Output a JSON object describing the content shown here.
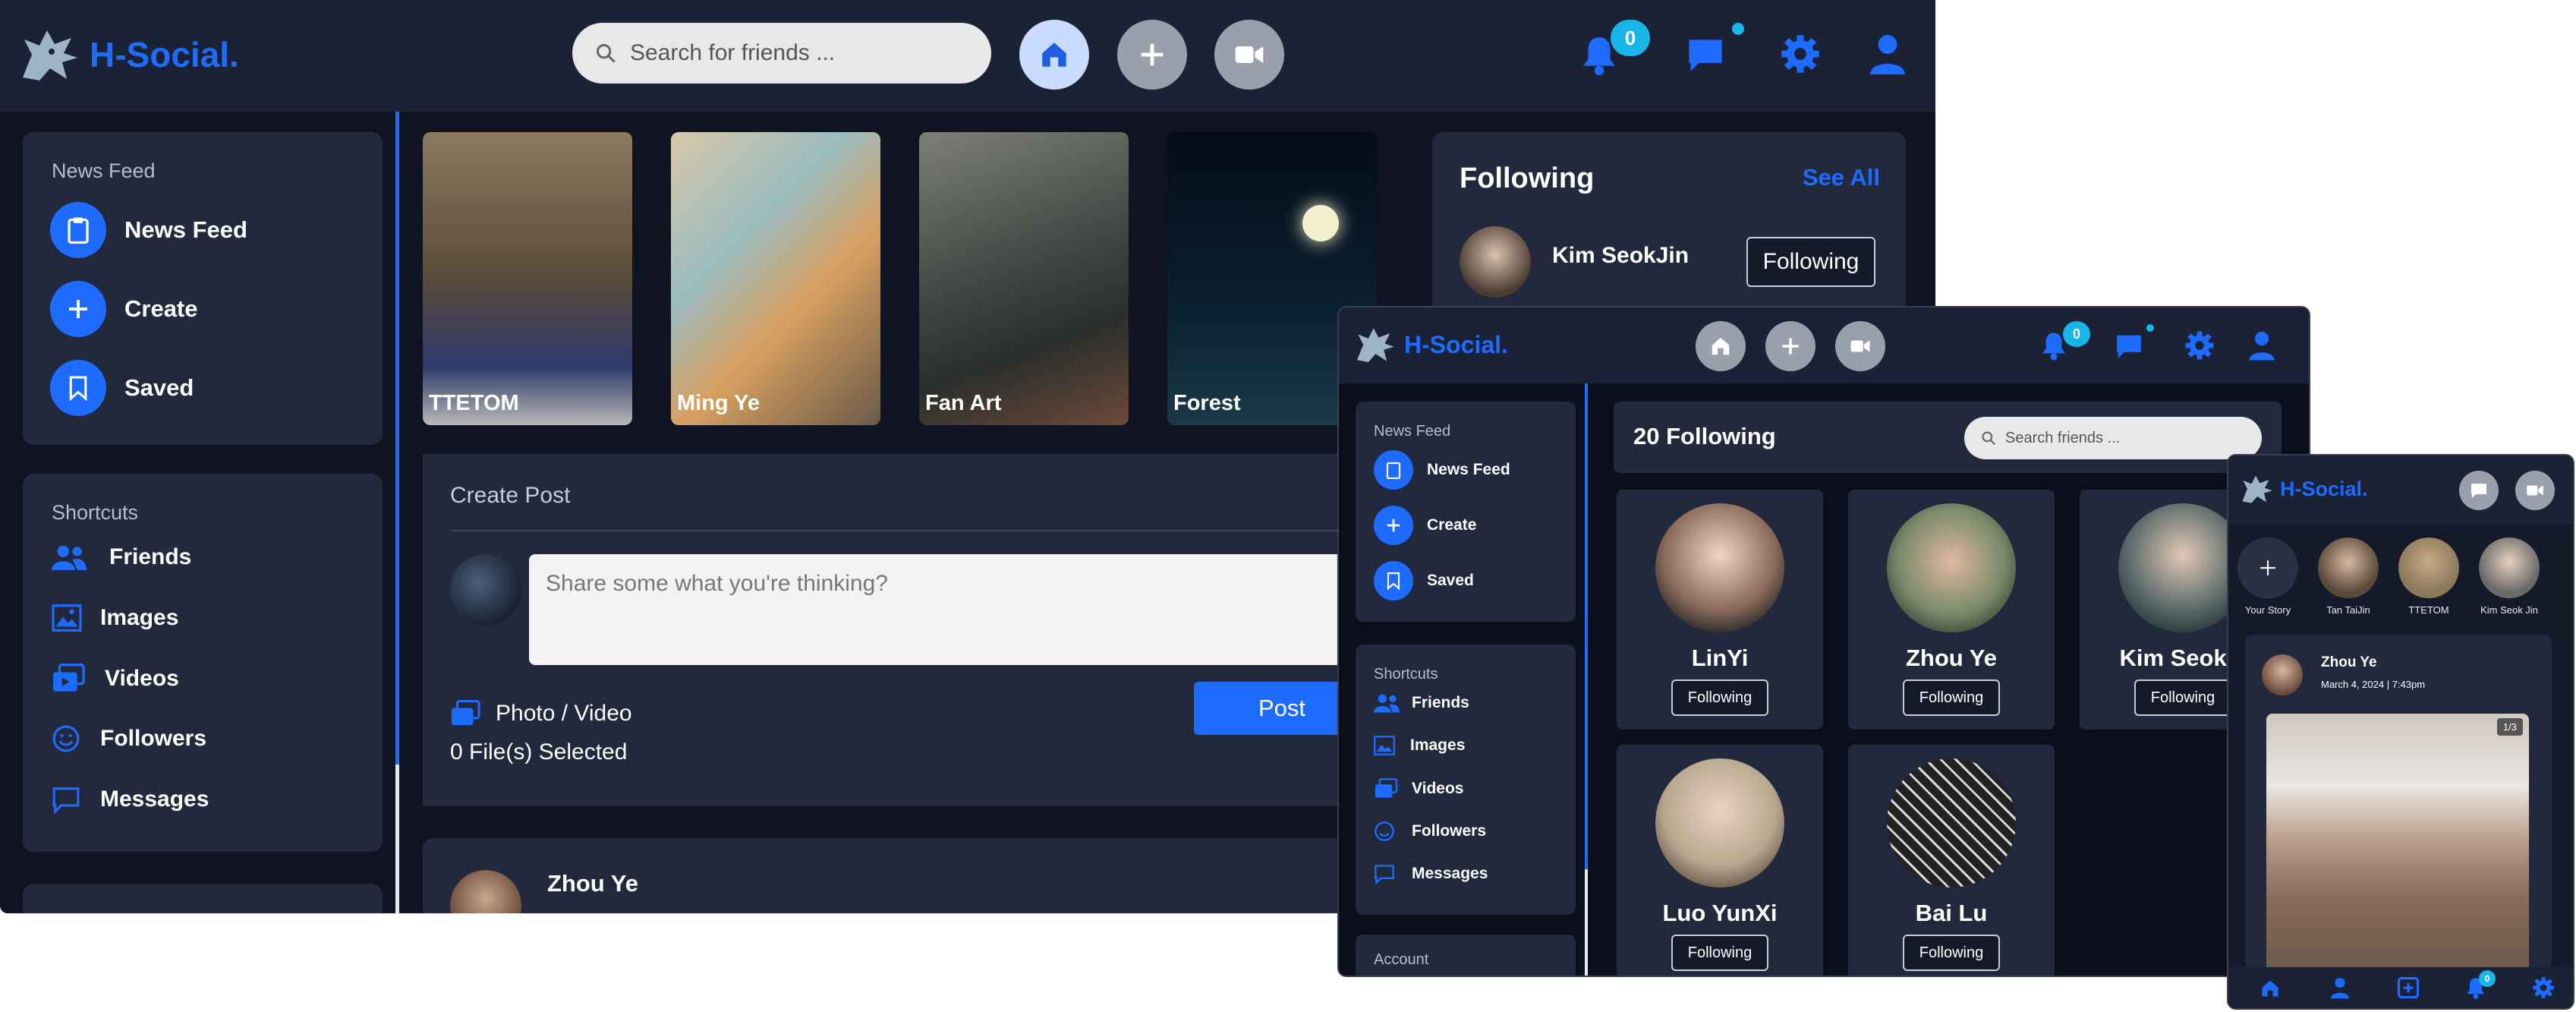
{
  "brand": "H-Social.",
  "desktop": {
    "search_placeholder": "Search for friends ...",
    "notification_count": "0",
    "sidebar": {
      "section1_title": "News Feed",
      "items": [
        {
          "label": "News Feed",
          "icon": "clipboard-icon"
        },
        {
          "label": "Create",
          "icon": "plus-icon"
        },
        {
          "label": "Saved",
          "icon": "bookmark-icon"
        }
      ],
      "section2_title": "Shortcuts",
      "shortcuts": [
        {
          "label": "Friends",
          "icon": "people-icon"
        },
        {
          "label": "Images",
          "icon": "image-icon"
        },
        {
          "label": "Videos",
          "icon": "videos-icon"
        },
        {
          "label": "Followers",
          "icon": "smile-icon"
        },
        {
          "label": "Messages",
          "icon": "chat-icon"
        }
      ]
    },
    "stories": [
      {
        "label": "TTETOM",
        "color": "#6b5a4a"
      },
      {
        "label": "Ming Ye",
        "color": "#b9a88a"
      },
      {
        "label": "Fan Art",
        "color": "#5a5e5a"
      },
      {
        "label": "Forest",
        "color": "#0d1b2a"
      }
    ],
    "create_post": {
      "title": "Create Post",
      "placeholder": "Share some what you're thinking?",
      "photo_video": "Photo / Video",
      "files_selected": "0 File(s) Selected",
      "post_button": "Post"
    },
    "following": {
      "title": "Following",
      "see_all": "See All",
      "person": "Kim SeokJin",
      "button": "Following"
    },
    "post": {
      "author": "Zhou Ye"
    }
  },
  "tablet": {
    "notification_count": "0",
    "sidebar": {
      "section1_title": "News Feed",
      "items": [
        "News Feed",
        "Create",
        "Saved"
      ],
      "section2_title": "Shortcuts",
      "shortcuts": [
        "Friends",
        "Images",
        "Videos",
        "Followers",
        "Messages"
      ],
      "section3_title": "Account"
    },
    "following_count": "20 Following",
    "search_placeholder": "Search friends ...",
    "follow_button": "Following",
    "people": [
      "LinYi",
      "Zhou Ye",
      "Kim Seok J",
      "Luo YunXi",
      "Bai Lu"
    ]
  },
  "mobile": {
    "stories": [
      "Your Story",
      "Tan TaiJin",
      "TTETOM",
      "Kim Seok Jin"
    ],
    "post": {
      "author": "Zhou Ye",
      "date": "March 4, 2024 | 7:43pm",
      "counter": "1/3"
    },
    "notification_count": "0"
  }
}
